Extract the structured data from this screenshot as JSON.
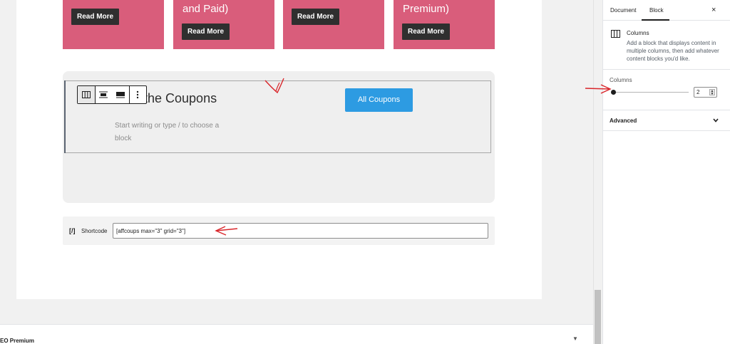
{
  "cards": [
    {
      "title": "",
      "button": "Read More"
    },
    {
      "title": "and Paid)",
      "button": "Read More"
    },
    {
      "title": "",
      "button": "Read More"
    },
    {
      "title": "Premium)",
      "button": "Read More"
    }
  ],
  "columns_block": {
    "heading": "k the Coupons",
    "placeholder": "Start writing or type / to choose a block",
    "button": "All Coupons"
  },
  "toolbar": {
    "icons": [
      "columns-icon",
      "align-wide-icon",
      "align-full-icon",
      "more-options-icon"
    ]
  },
  "shortcode": {
    "icon": "[/]",
    "label": "Shortcode",
    "value": "[affcoups max=\"3\" grid=\"3\"]"
  },
  "meta_box": {
    "title": "EO Premium",
    "toggle": "▼"
  },
  "sidebar": {
    "tabs": [
      "Document",
      "Block"
    ],
    "active_tab": "Block",
    "close": "×",
    "block_card": {
      "title": "Columns",
      "description": "Add a block that displays content in multiple columns, then add whatever content blocks you'd like."
    },
    "columns_setting": {
      "label": "Columns",
      "value": "2"
    },
    "advanced": {
      "label": "Advanced"
    }
  },
  "colors": {
    "card_pink": "#d95d7b",
    "button_dark": "#2f2f2f",
    "coupon_blue": "#2d9be2",
    "annotation_red": "#d9252a"
  }
}
